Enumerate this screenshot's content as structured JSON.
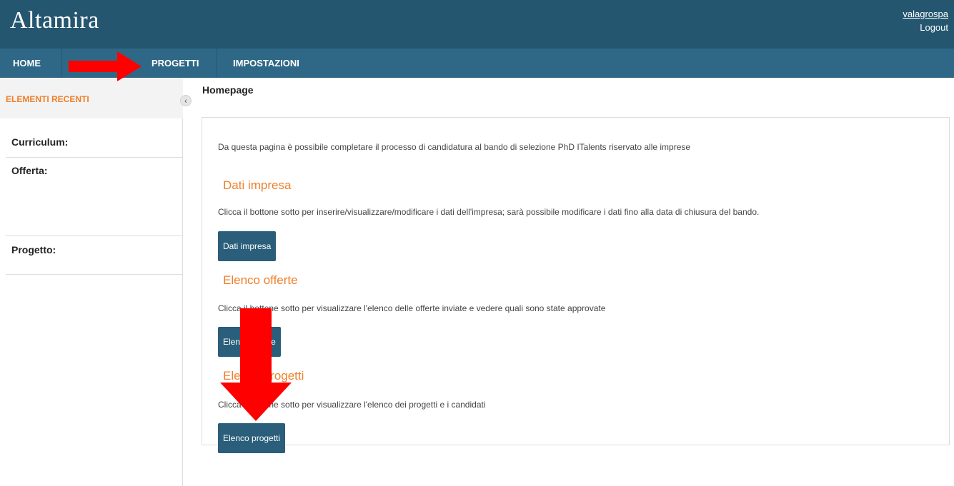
{
  "app": {
    "logo": "Altamira",
    "username": "valagrospa",
    "logout_label": "Logout"
  },
  "nav": {
    "items": [
      {
        "label": "HOME"
      },
      {
        "label": "PROGETTI"
      },
      {
        "label": "IMPOSTAZIONI"
      }
    ]
  },
  "sidebar": {
    "recent_title": "ELEMENTI RECENTI",
    "toggle_glyph": "‹",
    "labels": {
      "curriculum": "Curriculum:",
      "offerta": "Offerta:",
      "progetto": "Progetto:"
    }
  },
  "main": {
    "page_title": "Homepage",
    "intro": "Da questa pagina è possibile completare il processo di candidatura al bando di selezione PhD ITalents riservato alle imprese",
    "sections": [
      {
        "title": "Dati impresa",
        "description": "Clicca il bottone sotto per inserire/visualizzare/modificare i dati dell'impresa; sarà possibile modificare i dati fino alla data di chiusura del bando.",
        "button_label": "Dati impresa"
      },
      {
        "title": "Elenco offerte",
        "description": "Clicca il bottone sotto per visualizzare l'elenco delle offerte inviate e vedere quali sono state approvate",
        "button_label": "Elenco offerte"
      },
      {
        "title": "Elenco progetti",
        "description": "Clicca il bottone sotto per visualizzare l'elenco dei progetti e i candidati",
        "button_label": "Elenco progetti"
      }
    ]
  },
  "colors": {
    "header_bg": "#245670",
    "nav_bg": "#2f6886",
    "accent_orange": "#f07f2b",
    "button_bg": "#2a5e7a",
    "annotation_arrow": "#ff0000"
  }
}
